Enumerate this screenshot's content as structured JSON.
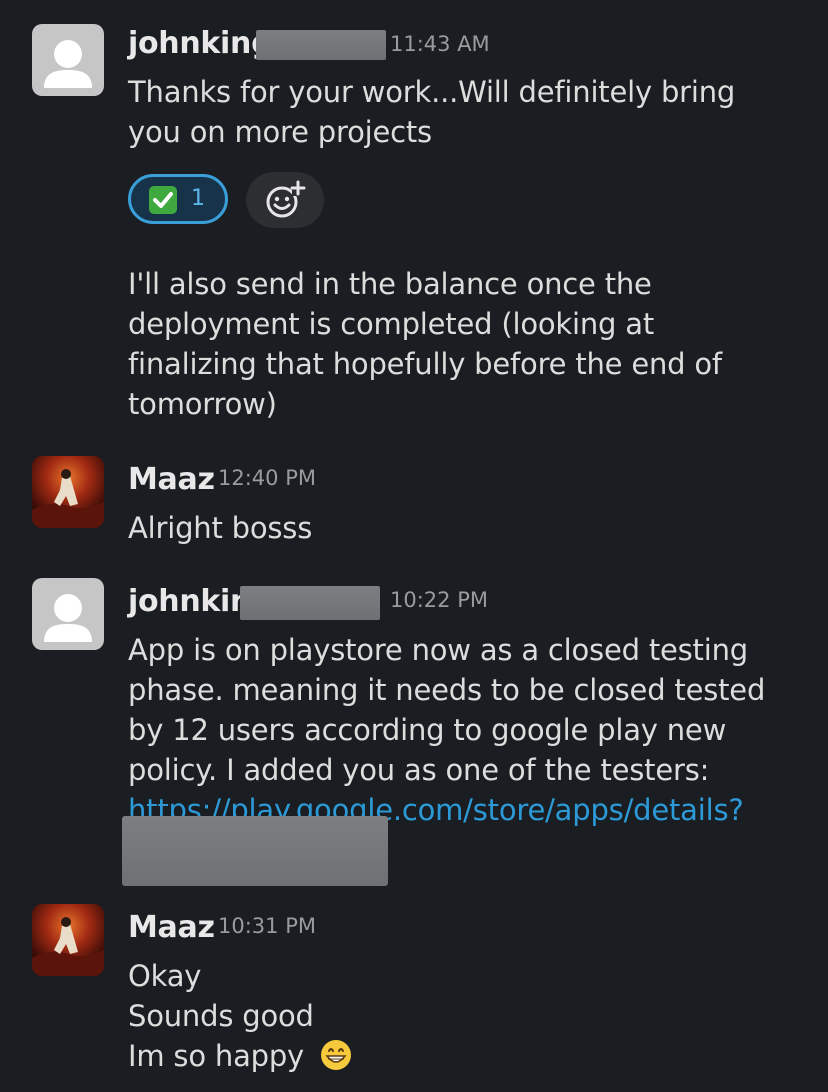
{
  "messages": [
    {
      "author": "johnking",
      "time": "11:43 AM",
      "lines": [
        "Thanks for your work...Will definitely bring",
        "you on more projects"
      ],
      "reaction": {
        "emoji": "white-check-mark",
        "count": "1"
      },
      "followup": [
        "I'll also send in the balance once the",
        "deployment is completed (looking at",
        "finalizing that hopefully before the end of",
        "tomorrow)"
      ]
    },
    {
      "author": "Maaz",
      "time": "12:40 PM",
      "lines": [
        "Alright bosss"
      ]
    },
    {
      "author": "johnkin",
      "time": "10:22 PM",
      "lines": [
        "App is on playstore now as a closed testing",
        "phase. meaning it needs to be closed tested",
        "by 12 users according to google play new",
        "policy. I added you as one of the testers:"
      ],
      "link": "https://play.google.com/store/apps/details?"
    },
    {
      "author": "Maaz",
      "time": "10:31 PM",
      "lines": [
        "Okay",
        "Sounds good",
        "Im so happy"
      ],
      "emoji": "grinning-face"
    }
  ],
  "colors": {
    "background": "#1a1d21",
    "link": "#2d9ad8",
    "reaction_border": "#3a9fd8"
  }
}
